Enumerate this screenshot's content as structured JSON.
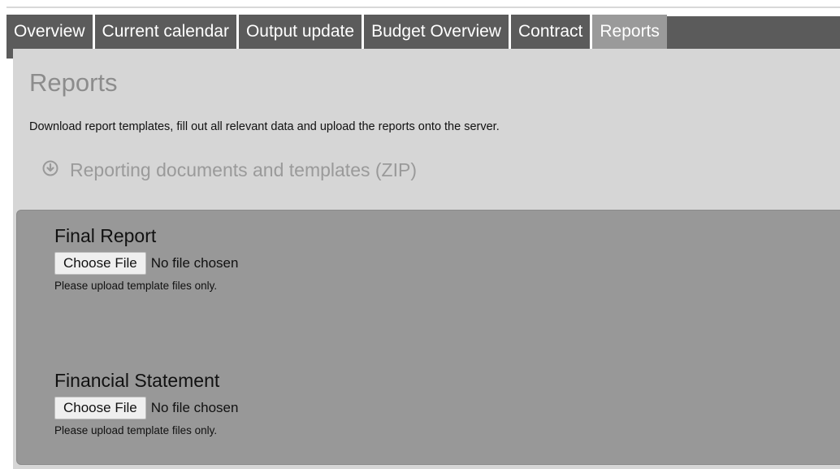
{
  "tabs": [
    {
      "label": "Overview",
      "active": false
    },
    {
      "label": "Current calendar",
      "active": false
    },
    {
      "label": "Output update",
      "active": false
    },
    {
      "label": "Budget Overview",
      "active": false
    },
    {
      "label": "Contract",
      "active": false
    },
    {
      "label": "Reports",
      "active": true
    }
  ],
  "page": {
    "title": "Reports",
    "intro": "Download report templates, fill out all relevant data and upload the reports onto the server.",
    "download_link": {
      "label": "Reporting documents and templates (ZIP)",
      "icon": "download-circle-icon"
    }
  },
  "uploads": [
    {
      "title": "Final Report",
      "button_label": "Choose File",
      "status": "No file chosen",
      "hint": "Please upload template files only."
    },
    {
      "title": "Financial Statement",
      "button_label": "Choose File",
      "status": "No file chosen",
      "hint": "Please upload template files only."
    }
  ],
  "colors": {
    "tab_bg": "#5b5b5b",
    "tab_active_bg": "#9a9a9a",
    "panel_bg": "#d6d6d6",
    "upload_box_bg": "#989898",
    "muted_text": "#8c8c8c"
  }
}
